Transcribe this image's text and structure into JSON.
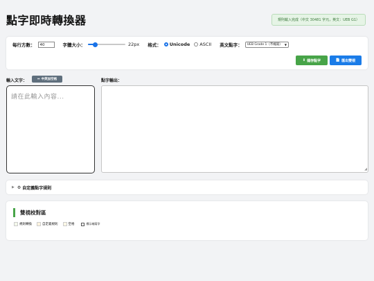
{
  "header": {
    "title": "點字即時轉換器",
    "status": "規則載入完成（中文 30481 字元，英文：UEB G1）"
  },
  "settings": {
    "cells_per_line_label": "每行方數：",
    "cells_per_line_value": "40",
    "font_size_label": "字體大小：",
    "font_size_value": "22px",
    "font_size_level": 0.2,
    "format_label": "格式：",
    "format_options": [
      "Unicode",
      "ASCII"
    ],
    "format_selected": "Unicode",
    "english_braille_label": "英文點字：",
    "english_braille_selected": "UEB Grade 1（不縮寫）",
    "save_button": "儲存點字",
    "export_button": "匯出雙視"
  },
  "input": {
    "label": "輸入文字：",
    "space_button": "中英加空格",
    "placeholder": "請在此輸入內容..."
  },
  "output": {
    "label": "點字輸出："
  },
  "custom_rules": {
    "label": "自定義點字規則"
  },
  "proofread": {
    "title": "雙視校對區",
    "legend": [
      {
        "label": "規則轉換",
        "color": "#f3f8ea"
      },
      {
        "label": "自定義規則",
        "color": "#fdf3df"
      },
      {
        "label": "空格",
        "color": "#fbf8e6"
      }
    ],
    "toggle_label": "標示縮寫字"
  },
  "colors": {
    "save": "#47a448",
    "export": "#1a7ce8",
    "accent": "#1a73e8"
  }
}
